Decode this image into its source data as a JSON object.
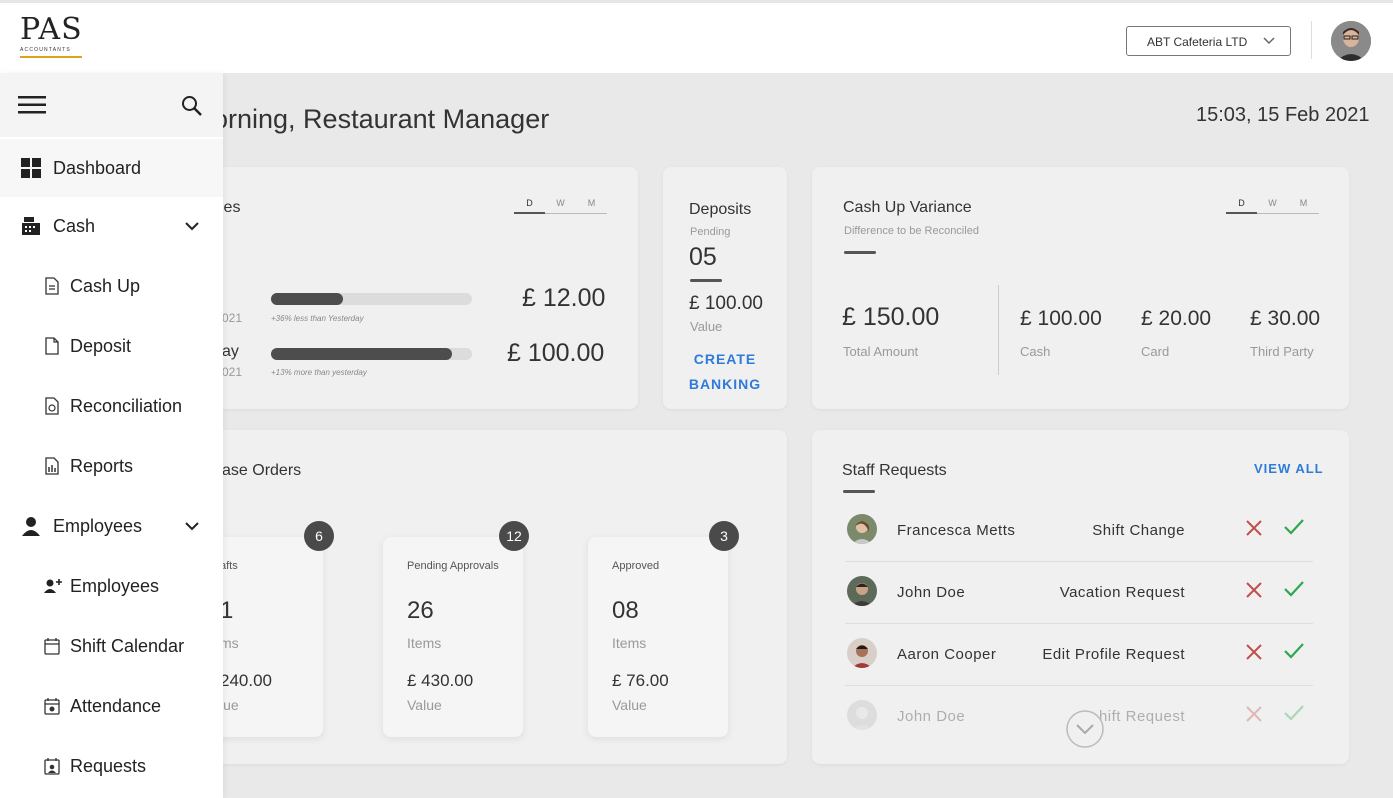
{
  "header": {
    "logo_letters": "PAS",
    "logo_sub": "ACCOUNTANTS",
    "company_select": "ABT Cafeteria LTD"
  },
  "main": {
    "greeting": "orning, Restaurant Manager",
    "datetime": "15:03,  15 Feb 2021"
  },
  "sales": {
    "title": "les",
    "tabs": [
      "D",
      "W",
      "M"
    ],
    "rows": [
      {
        "label_frag": "",
        "date_frag": "021",
        "progress": 0.36,
        "note": "+36% less than Yesterday",
        "value": "£ 12.00"
      },
      {
        "label_frag": "ay",
        "date_frag": "021",
        "progress": 0.9,
        "note": "+13% more than yesterday",
        "value": "£ 100.00"
      }
    ]
  },
  "deposits": {
    "title": "Deposits",
    "pending_label": "Pending",
    "pending_count": "05",
    "value": "£ 100.00",
    "value_label": "Value",
    "action_line1": "CREATE",
    "action_line2": "BANKING"
  },
  "variance": {
    "title": "Cash Up Variance",
    "subtitle": "Difference to be Reconciled",
    "tabs": [
      "D",
      "W",
      "M"
    ],
    "total": "£ 150.00",
    "total_label": "Total Amount",
    "cash": "£ 100.00",
    "cash_label": "Cash",
    "card": "£ 20.00",
    "card_label": "Card",
    "third": "£ 30.00",
    "third_label": "Third Party"
  },
  "orders": {
    "title": "ase Orders",
    "boxes": [
      {
        "title": "afts",
        "count": "1",
        "count_label": "ms",
        "value": "240.00",
        "value_label": "lue",
        "badge": "6"
      },
      {
        "title": "Pending Approvals",
        "count": "26",
        "count_label": "Items",
        "value": "£ 430.00",
        "value_label": "Value",
        "badge": "12"
      },
      {
        "title": "Approved",
        "count": "08",
        "count_label": "Items",
        "value": "£ 76.00",
        "value_label": "Value",
        "badge": "3"
      }
    ]
  },
  "staff": {
    "title": "Staff Requests",
    "view_all": "VIEW ALL",
    "rows": [
      {
        "name": "Francesca Metts",
        "request": "Shift Change"
      },
      {
        "name": "John Doe",
        "request": "Vacation Request"
      },
      {
        "name": "Aaron Cooper",
        "request": "Edit Profile Request"
      },
      {
        "name": "John Doe",
        "request": "hift Request"
      }
    ]
  },
  "sidebar": {
    "items": [
      {
        "label": "Dashboard",
        "icon": "dashboard-icon"
      },
      {
        "label": "Cash",
        "icon": "cash-register-icon"
      },
      {
        "label": "Cash Up",
        "icon": "document-icon"
      },
      {
        "label": "Deposit",
        "icon": "document-icon"
      },
      {
        "label": "Reconciliation",
        "icon": "document-money-icon"
      },
      {
        "label": "Reports",
        "icon": "report-icon"
      },
      {
        "label": "Employees",
        "icon": "person-icon"
      },
      {
        "label": "Employees",
        "icon": "people-icon"
      },
      {
        "label": "Shift Calendar",
        "icon": "calendar-icon"
      },
      {
        "label": "Attendance",
        "icon": "calendar-check-icon"
      },
      {
        "label": "Requests",
        "icon": "request-icon"
      }
    ]
  },
  "colors": {
    "accent_blue": "#2f7bd9",
    "reject_red": "#c0504d",
    "approve_green": "#2fa84f",
    "logo_gold": "#e0a21e"
  }
}
